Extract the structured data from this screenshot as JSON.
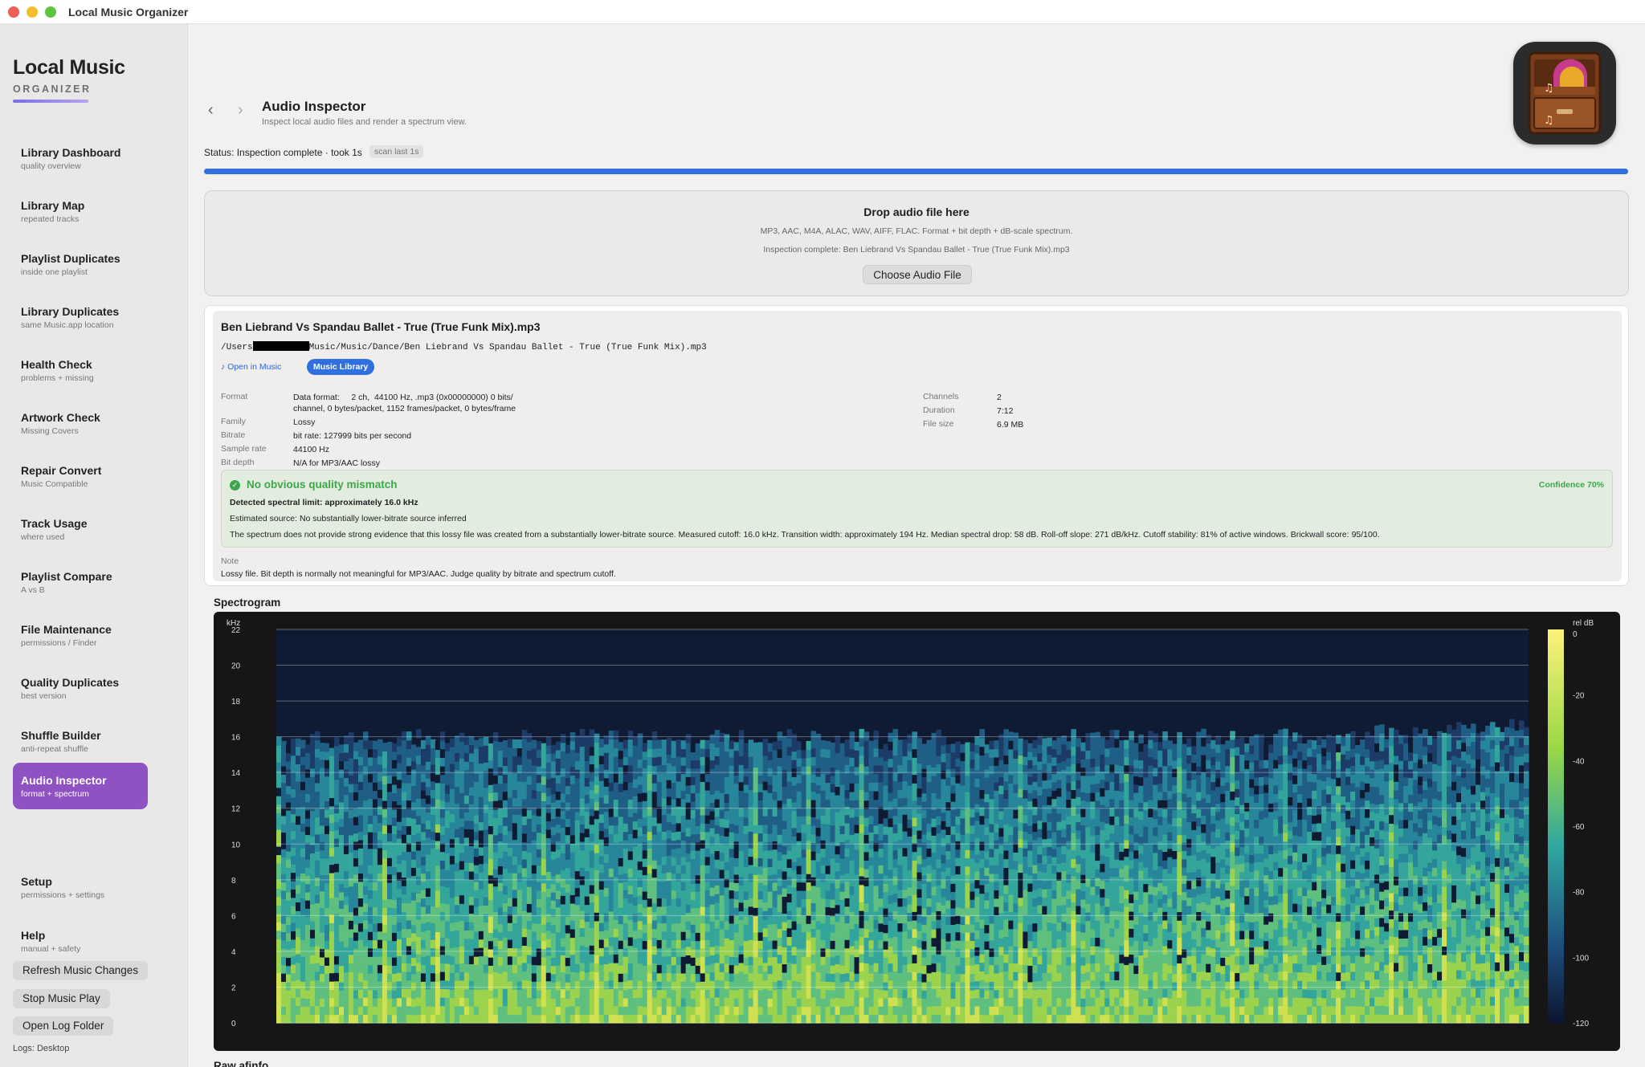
{
  "window": {
    "title": "Local Music Organizer"
  },
  "sidebar": {
    "brand": "Local Music",
    "brand_sub": "ORGANIZER",
    "items": [
      {
        "label": "Library Dashboard",
        "sub": "quality overview"
      },
      {
        "label": "Library Map",
        "sub": "repeated tracks"
      },
      {
        "label": "Playlist Duplicates",
        "sub": "inside one playlist"
      },
      {
        "label": "Library Duplicates",
        "sub": "same Music.app location"
      },
      {
        "label": "Health Check",
        "sub": "problems + missing"
      },
      {
        "label": "Artwork Check",
        "sub": "Missing Covers"
      },
      {
        "label": "Repair Convert",
        "sub": "Music Compatible"
      },
      {
        "label": "Track Usage",
        "sub": "where used"
      },
      {
        "label": "Playlist Compare",
        "sub": "A vs B"
      },
      {
        "label": "File Maintenance",
        "sub": "permissions / Finder"
      },
      {
        "label": "Quality Duplicates",
        "sub": "best version"
      },
      {
        "label": "Shuffle Builder",
        "sub": "anti-repeat shuffle"
      },
      {
        "label": "Audio Inspector",
        "sub": "format + spectrum"
      }
    ],
    "setup": {
      "label": "Setup",
      "sub": "permissions + settings"
    },
    "help": {
      "label": "Help",
      "sub": "manual + safety"
    },
    "buttons": {
      "refresh": "Refresh Music Changes",
      "stop": "Stop Music Play",
      "open_log": "Open Log Folder"
    },
    "logs": "Logs: Desktop"
  },
  "header": {
    "title": "Audio Inspector",
    "subtitle": "Inspect local audio files and render a spectrum view.",
    "back": "‹",
    "forward": "›"
  },
  "status": {
    "text": "Status: Inspection complete · took 1s",
    "pill": "scan last 1s",
    "progress": 1.0
  },
  "dropzone": {
    "title": "Drop audio file here",
    "formats": "MP3, AAC, M4A, ALAC, WAV, AIFF, FLAC. Format + bit depth + dB-scale spectrum.",
    "status": "Inspection complete: Ben Liebrand Vs Spandau Ballet - True (True Funk Mix).mp3",
    "button": "Choose Audio File"
  },
  "file": {
    "name": "Ben Liebrand Vs Spandau Ballet - True (True Funk Mix).mp3",
    "path_prefix": "/Users",
    "path_suffix": "Music/Music/Dance/Ben Liebrand Vs Spandau Ballet - True (True Funk Mix).mp3",
    "open_in_music": "Open in Music",
    "library_badge": "Music Library",
    "left": [
      {
        "k": "Format",
        "v1": "Data format:     2 ch,  44100 Hz, .mp3 (0x00000000) 0 bits/",
        "v2": "channel, 0 bytes/packet, 1152 frames/packet, 0 bytes/frame"
      },
      {
        "k": "Family",
        "v": "Lossy"
      },
      {
        "k": "Bitrate",
        "v": "bit rate: 127999 bits per second"
      },
      {
        "k": "Sample rate",
        "v": "44100 Hz"
      },
      {
        "k": "Bit depth",
        "v": "N/A for MP3/AAC lossy"
      }
    ],
    "right": [
      {
        "k": "Channels",
        "v": "2"
      },
      {
        "k": "Duration",
        "v": "7:12"
      },
      {
        "k": "File size",
        "v": "6.9 MB"
      }
    ],
    "quality": {
      "icon": "check-circle-icon",
      "title": "No obvious quality mismatch",
      "confidence": "Confidence 70%",
      "limit": "Detected spectral limit: approximately 16.0 kHz",
      "estimated": "Estimated source: No substantially lower-bitrate source inferred",
      "description": "The spectrum does not provide strong evidence that this lossy file was created from a substantially lower-bitrate source. Measured cutoff: 16.0 kHz. Transition width: approximately 194 Hz. Median spectral drop: 58 dB. Roll-off slope: 271 dB/kHz. Cutoff stability: 81% of active windows. Brickwall score: 95/100."
    },
    "note_label": "Note",
    "note": "Lossy file. Bit depth is normally not meaningful for MP3/AAC. Judge quality by bitrate and spectrum cutoff."
  },
  "spectrogram": {
    "title": "Spectrogram",
    "y_unit": "kHz",
    "y_ticks": [
      "22",
      "20",
      "18",
      "16",
      "14",
      "12",
      "10",
      "8",
      "6",
      "4",
      "2",
      "0"
    ],
    "cutoff_khz": 16,
    "max_khz": 22,
    "colorbar_unit": "rel dB",
    "colorbar_ticks": [
      "0",
      "-20",
      "-40",
      "-60",
      "-80",
      "-100",
      "-120"
    ]
  },
  "raw": {
    "title": "Raw afinfo"
  }
}
